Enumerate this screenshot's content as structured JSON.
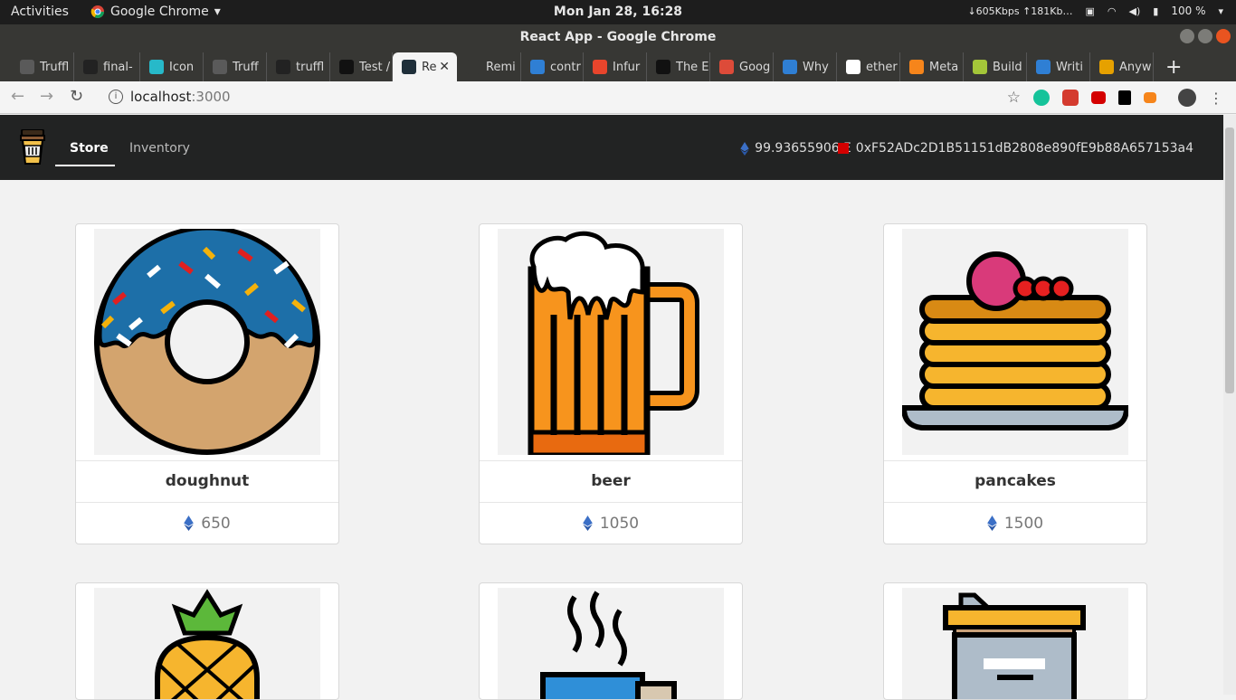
{
  "os_bar": {
    "activities": "Activities",
    "app_menu": "Google Chrome",
    "clock": "Mon Jan 28, 16:28",
    "net_speed": "↓605Kbps ↑181Kb…",
    "battery": "100 %"
  },
  "window": {
    "title": "React App - Google Chrome"
  },
  "tabs": [
    {
      "label": "Truffl",
      "fav_color": "#5a5a5a"
    },
    {
      "label": "final-",
      "fav_color": "#222222"
    },
    {
      "label": "Icon",
      "fav_color": "#27b9c9"
    },
    {
      "label": "Truff",
      "fav_color": "#5a5a5a"
    },
    {
      "label": "truffl",
      "fav_color": "#222222"
    },
    {
      "label": "Test /",
      "fav_color": "#111111"
    },
    {
      "label": "Re",
      "fav_color": "#1f2f3a",
      "active": true
    },
    {
      "label": "Remi",
      "fav_color": "#373734"
    },
    {
      "label": "contr",
      "fav_color": "#2f7fd4"
    },
    {
      "label": "Infur",
      "fav_color": "#e8452c"
    },
    {
      "label": "The E",
      "fav_color": "#111111"
    },
    {
      "label": "Goog",
      "fav_color": "#dd4b39"
    },
    {
      "label": "Why",
      "fav_color": "#2f7fd4"
    },
    {
      "label": "ether",
      "fav_color": "#ffffff"
    },
    {
      "label": "Meta",
      "fav_color": "#f6851b"
    },
    {
      "label": "Build",
      "fav_color": "#a4c639"
    },
    {
      "label": "Writi",
      "fav_color": "#2f7fd4"
    },
    {
      "label": "Anyw",
      "fav_color": "#e6a100"
    }
  ],
  "address": {
    "host": "localhost",
    "port": ":3000"
  },
  "app": {
    "nav": {
      "store": "Store",
      "inventory": "Inventory"
    },
    "balance": "99.93655906 Ξ",
    "account": "0xF52ADc2D1B51151dB2808e890fE9b88A657153a4"
  },
  "products": [
    {
      "name": "doughnut",
      "price": "650"
    },
    {
      "name": "beer",
      "price": "1050"
    },
    {
      "name": "pancakes",
      "price": "1500"
    },
    {
      "name": "",
      "price": ""
    },
    {
      "name": "",
      "price": ""
    },
    {
      "name": "",
      "price": ""
    }
  ],
  "colors": {
    "navbar": "#222323",
    "eth_blue": "#3b6fc6",
    "account_red": "#d40000"
  }
}
